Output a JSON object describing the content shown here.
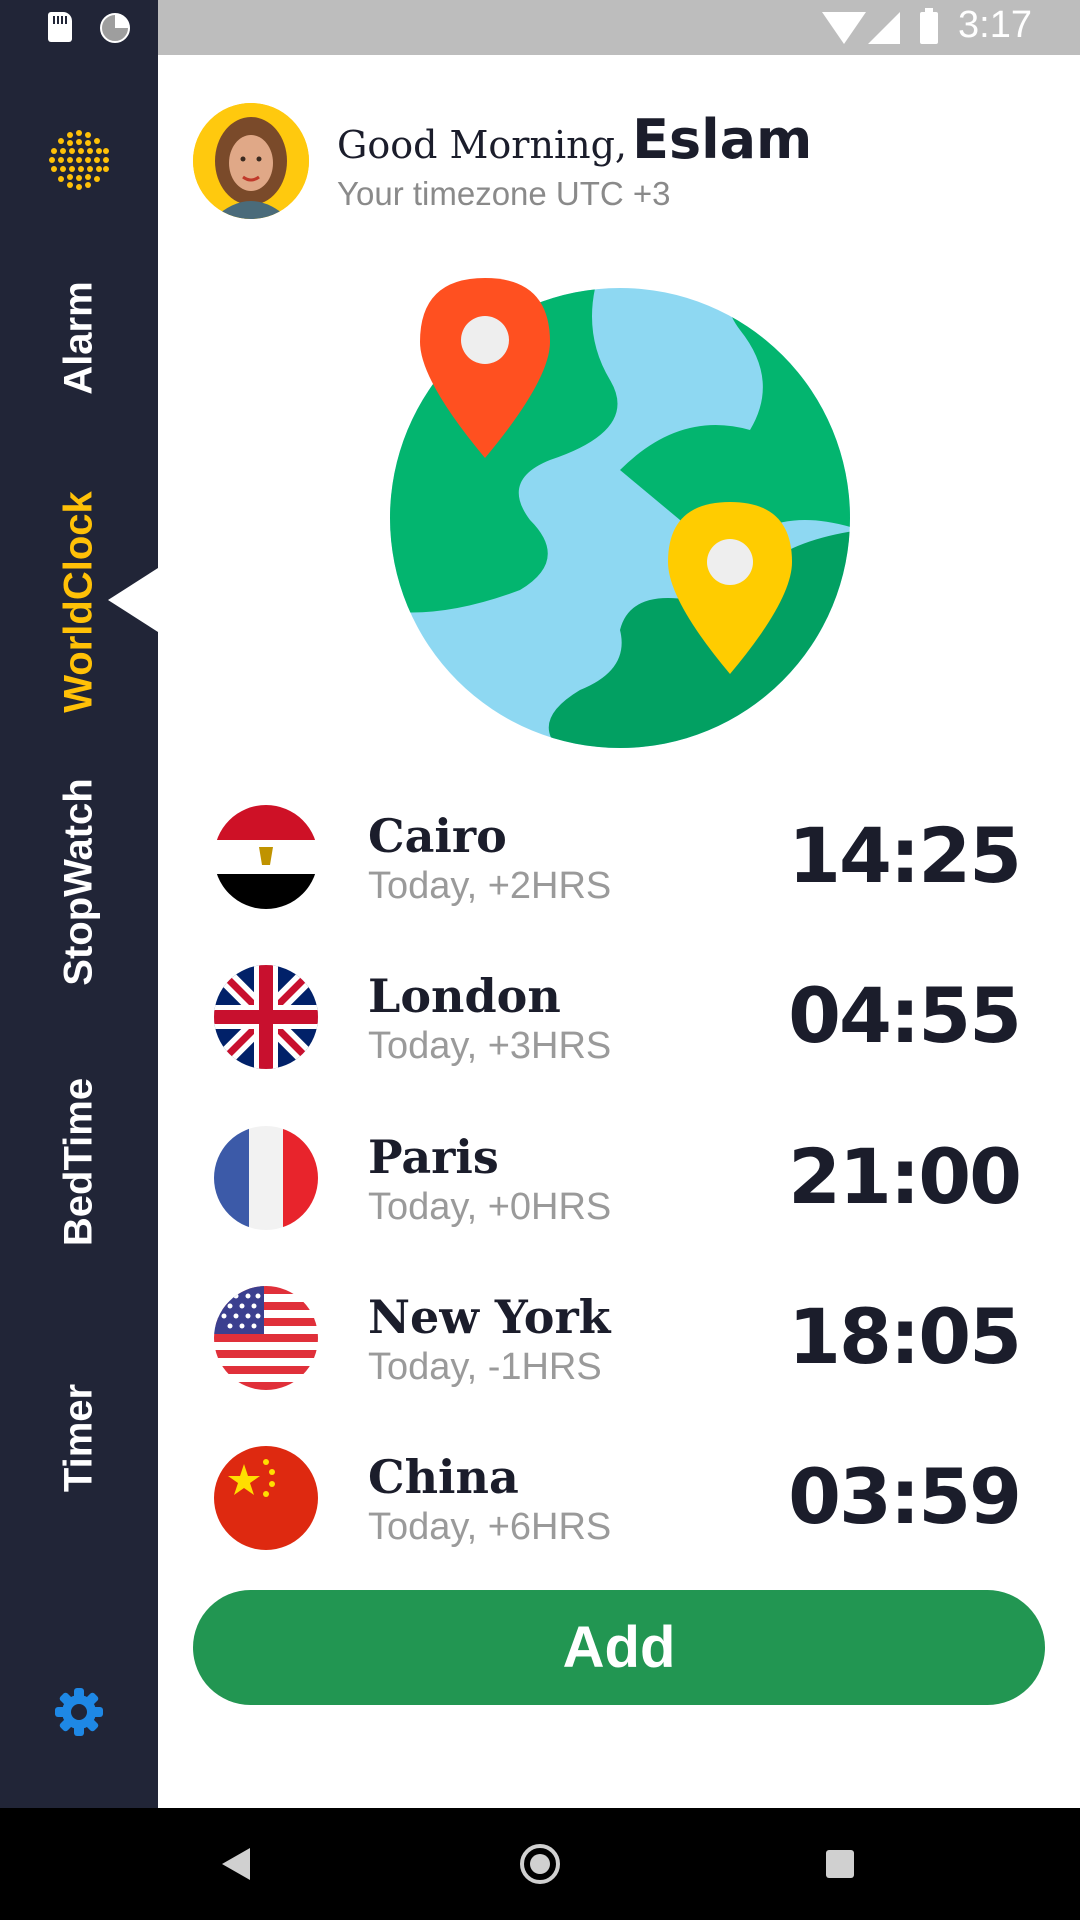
{
  "status_bar": {
    "time": "3:17"
  },
  "sidebar": {
    "items": [
      {
        "label": "Alarm"
      },
      {
        "label": "WorldClock"
      },
      {
        "label": "StopWatch"
      },
      {
        "label": "BedTime"
      },
      {
        "label": "Timer"
      }
    ],
    "active_item": "WorldClock",
    "accent_color": "#ffc107",
    "background_color": "#212537",
    "settings_icon": "gear-icon"
  },
  "header": {
    "greeting": "Good Morning,",
    "user_name": "Eslam",
    "timezone": "Your timezone UTC +3"
  },
  "illustration": {
    "icon": "globe-with-location-pins-icon"
  },
  "cities": [
    {
      "name": "Cairo",
      "offset": "Today, +2HRS",
      "time": "14:25",
      "flag": "egypt-flag-icon"
    },
    {
      "name": "London",
      "offset": "Today, +3HRS",
      "time": "04:55",
      "flag": "uk-flag-icon"
    },
    {
      "name": "Paris",
      "offset": "Today, +0HRS",
      "time": "21:00",
      "flag": "france-flag-icon"
    },
    {
      "name": "New York",
      "offset": "Today, -1HRS",
      "time": "18:05",
      "flag": "usa-flag-icon"
    },
    {
      "name": "China",
      "offset": "Today, +6HRS",
      "time": "03:59",
      "flag": "china-flag-icon"
    }
  ],
  "add_button": {
    "label": "Add",
    "color": "#229652"
  }
}
